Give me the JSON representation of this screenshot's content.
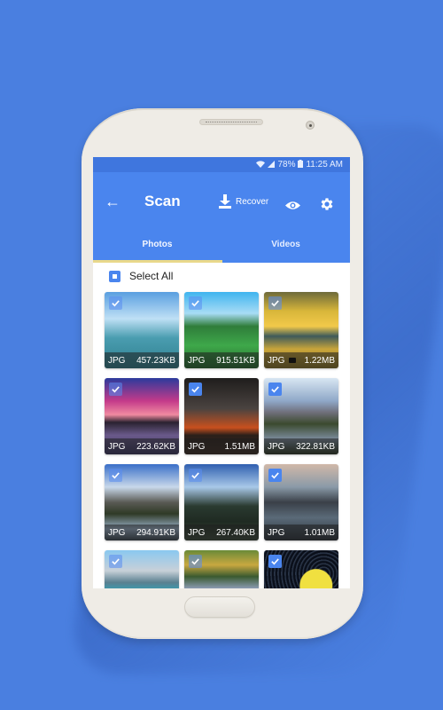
{
  "status_bar": {
    "wifi_icon": "wifi-icon",
    "signal_icon": "signal-icon",
    "battery": "78%",
    "battery_icon": "battery-icon",
    "time": "11:25 AM"
  },
  "app_bar": {
    "back_icon": "arrow-left-icon",
    "back_glyph": "←",
    "title": "Scan",
    "recover_label": "Recover",
    "recover_icon": "download-icon",
    "preview_icon": "eye-icon",
    "settings_icon": "gear-icon"
  },
  "tabs": [
    {
      "label": "Photos",
      "active": true
    },
    {
      "label": "Videos",
      "active": false
    }
  ],
  "select_all_label": "Select All",
  "colors": {
    "background": "#4a7fe0",
    "app_bar": "#4a85ee",
    "status_bar": "#3f76de",
    "tab_indicator": "#e9d88b",
    "checkbox": "#4a85ee"
  },
  "photos": [
    {
      "type": "JPG",
      "size": "457.23KB",
      "checked": true,
      "faded": true
    },
    {
      "type": "JPG",
      "size": "915.51KB",
      "checked": true,
      "faded": true
    },
    {
      "type": "JPG",
      "size": "1.22MB",
      "checked": true,
      "faded": true,
      "has_camera_mark": true
    },
    {
      "type": "JPG",
      "size": "223.62KB",
      "checked": true,
      "faded": true
    },
    {
      "type": "JPG",
      "size": "1.51MB",
      "checked": true,
      "faded": false
    },
    {
      "type": "JPG",
      "size": "322.81KB",
      "checked": true,
      "faded": false
    },
    {
      "type": "JPG",
      "size": "294.91KB",
      "checked": true,
      "faded": true
    },
    {
      "type": "JPG",
      "size": "267.40KB",
      "checked": true,
      "faded": true
    },
    {
      "type": "JPG",
      "size": "1.01MB",
      "checked": true,
      "faded": false
    },
    {
      "type": "",
      "size": "",
      "checked": true,
      "faded": true
    },
    {
      "type": "",
      "size": "",
      "checked": true,
      "faded": true
    },
    {
      "type": "",
      "size": "",
      "checked": true,
      "faded": false
    }
  ]
}
